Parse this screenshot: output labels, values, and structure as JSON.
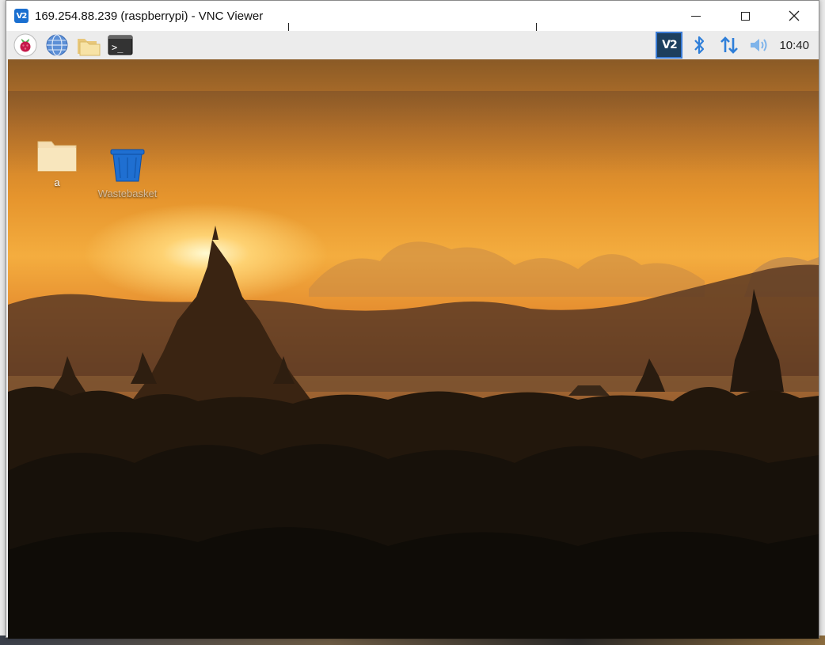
{
  "window": {
    "title": "169.254.88.239 (raspberrypi) - VNC Viewer",
    "app_icon_text": "V2"
  },
  "panel": {
    "launchers": [
      "raspberry-menu-icon",
      "web-browser-icon",
      "file-manager-icon",
      "terminal-icon"
    ],
    "tray": [
      "vnc-server-icon",
      "bluetooth-icon",
      "network-icon",
      "volume-icon"
    ],
    "vnc_tray_text": "V2",
    "clock": "10:40",
    "terminal_glyph": ">_"
  },
  "desktop": {
    "icons": [
      {
        "label": "a",
        "icon": "folder-icon"
      },
      {
        "label": "Wastebasket",
        "icon": "wastebasket-icon"
      }
    ]
  },
  "colors": {
    "panel_bg": "#ececec",
    "vnc_blue": "#1a6fd0",
    "tray_blue": "#2f7fd9",
    "folder": "#f5deb3"
  }
}
